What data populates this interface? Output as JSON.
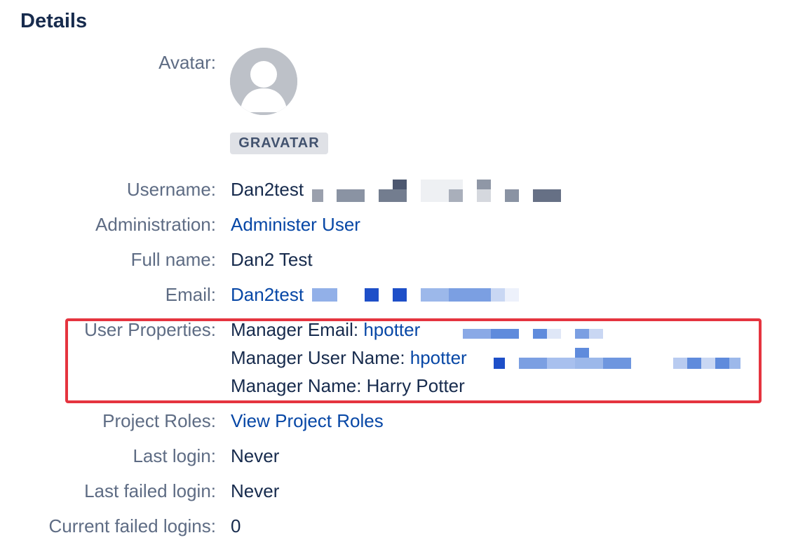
{
  "title": "Details",
  "avatar": {
    "label": "Avatar:",
    "icon": "default-user-avatar-icon",
    "badge": "GRAVATAR"
  },
  "username": {
    "label": "Username:",
    "value": "Dan2test"
  },
  "administration": {
    "label": "Administration:",
    "link": "Administer User"
  },
  "full_name": {
    "label": "Full name:",
    "value": "Dan2 Test"
  },
  "email": {
    "label": "Email:",
    "link": "Dan2test"
  },
  "user_properties": {
    "label": "User Properties:",
    "manager_email": {
      "key": "Manager Email: ",
      "link": "hpotter"
    },
    "manager_user_name": {
      "key": "Manager User Name: ",
      "link": "hpotter"
    },
    "manager_name": {
      "key": "Manager Name: Harry Potter"
    }
  },
  "project_roles": {
    "label": "Project Roles:",
    "link": "View Project Roles"
  },
  "last_login": {
    "label": "Last login:",
    "value": "Never"
  },
  "last_failed_login": {
    "label": "Last failed login:",
    "value": "Never"
  },
  "current_failed_logins": {
    "label": "Current failed logins:",
    "value": "0"
  },
  "colors": {
    "text": "#172b4d",
    "label": "#5e6c84",
    "link": "#0747a6",
    "highlight": "#e5343f",
    "badge_bg": "#dfe1e6"
  }
}
